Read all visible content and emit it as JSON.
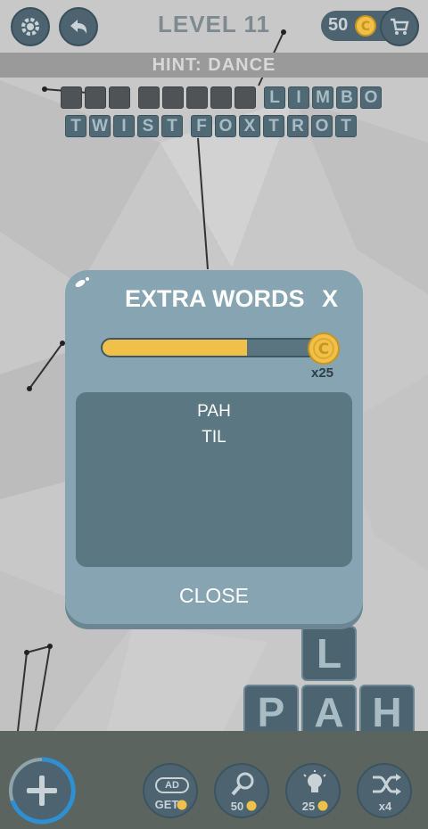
{
  "header": {
    "level_title": "LEVEL 11",
    "coins": "50"
  },
  "hint": "HINT: DANCE",
  "board": {
    "row1": {
      "hidden_words": [
        3,
        5
      ],
      "shown_word": [
        "L",
        "I",
        "M",
        "B",
        "O"
      ]
    },
    "row2": {
      "words": [
        [
          "T",
          "W",
          "I",
          "S",
          "T"
        ],
        [
          "F",
          "O",
          "X",
          "T",
          "R",
          "O",
          "T"
        ]
      ]
    }
  },
  "modal": {
    "title": "EXTRA WORDS",
    "close_x": "X",
    "progress_fraction": 0.66,
    "reward_multiplier": "x25",
    "words": [
      "PAH",
      "TIL"
    ],
    "close_label": "CLOSE"
  },
  "letters": [
    "L",
    "P",
    "A",
    "H"
  ],
  "tools": {
    "ad_label": "GET",
    "ad_badge": "AD",
    "hint_cost": "50",
    "bulb_cost": "25",
    "shuffle_count": "x4"
  },
  "colors": {
    "accent_gold": "#f0c04a",
    "tile_blue": "#4f6a75",
    "modal_bg": "#86a4b1"
  }
}
